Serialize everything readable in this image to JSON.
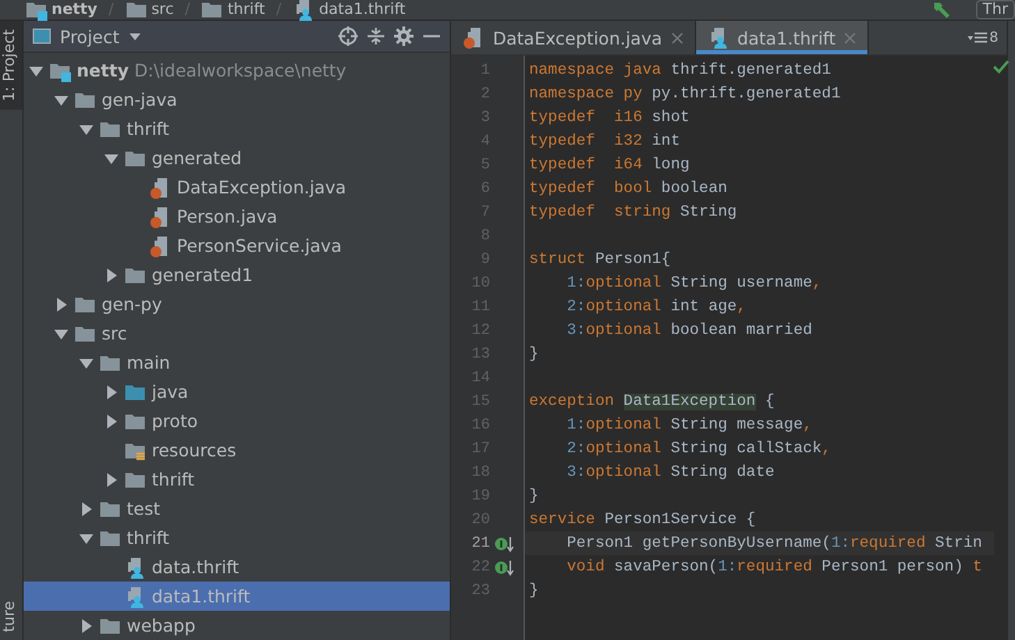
{
  "breadcrumb": [
    {
      "label": "netty",
      "kind": "module"
    },
    {
      "label": "src",
      "kind": "folder"
    },
    {
      "label": "thrift",
      "kind": "folder"
    },
    {
      "label": "data1.thrift",
      "kind": "thrift"
    }
  ],
  "breadcrumb_separator": "/",
  "top_right_label": "Thr",
  "side_tabs": {
    "top": "1: Project",
    "bottom": "ture"
  },
  "project_panel": {
    "title": "Project"
  },
  "tree": [
    {
      "name": "netty",
      "path": "D:\\idealworkspace\\netty",
      "kind": "module",
      "expanded": true,
      "selected": false,
      "children": [
        {
          "name": "gen-java",
          "kind": "folder",
          "expanded": true,
          "selected": false,
          "children": [
            {
              "name": "thrift",
              "kind": "folder",
              "expanded": true,
              "selected": false,
              "children": [
                {
                  "name": "generated",
                  "kind": "folder",
                  "expanded": true,
                  "selected": false,
                  "children": [
                    {
                      "name": "DataException.java",
                      "kind": "java",
                      "selected": false
                    },
                    {
                      "name": "Person.java",
                      "kind": "java",
                      "selected": false
                    },
                    {
                      "name": "PersonService.java",
                      "kind": "java",
                      "selected": false
                    }
                  ]
                },
                {
                  "name": "generated1",
                  "kind": "folder",
                  "expanded": false,
                  "selected": false
                }
              ]
            }
          ]
        },
        {
          "name": "gen-py",
          "kind": "folder",
          "expanded": false,
          "selected": false
        },
        {
          "name": "src",
          "kind": "folder",
          "expanded": true,
          "selected": false,
          "children": [
            {
              "name": "main",
              "kind": "folder",
              "expanded": true,
              "selected": false,
              "children": [
                {
                  "name": "java",
                  "kind": "source",
                  "expanded": false,
                  "selected": false
                },
                {
                  "name": "proto",
                  "kind": "folder",
                  "expanded": false,
                  "selected": false
                },
                {
                  "name": "resources",
                  "kind": "resources",
                  "selected": false
                },
                {
                  "name": "thrift",
                  "kind": "folder",
                  "expanded": false,
                  "selected": false
                }
              ]
            },
            {
              "name": "test",
              "kind": "folder",
              "expanded": false,
              "selected": false
            },
            {
              "name": "thrift",
              "kind": "folder",
              "expanded": true,
              "selected": false,
              "children": [
                {
                  "name": "data.thrift",
                  "kind": "thrift",
                  "selected": false
                },
                {
                  "name": "data1.thrift",
                  "kind": "thrift",
                  "selected": true
                }
              ]
            },
            {
              "name": "webapp",
              "kind": "folder",
              "expanded": false,
              "selected": false
            }
          ]
        }
      ]
    }
  ],
  "editor_tabs": [
    {
      "label": "DataException.java",
      "kind": "java",
      "selected": false
    },
    {
      "label": "data1.thrift",
      "kind": "thrift",
      "selected": true
    }
  ],
  "tab_overflow_count": "8",
  "code": [
    {
      "number": "1",
      "current": false,
      "marker": false,
      "tokens": [
        {
          "kind": "kw",
          "text": "namespace java "
        },
        {
          "kind": "id",
          "text": "thrift.generated1"
        }
      ]
    },
    {
      "number": "2",
      "current": false,
      "marker": false,
      "tokens": [
        {
          "kind": "kw",
          "text": "namespace py "
        },
        {
          "kind": "id",
          "text": "py.thrift.generated1"
        }
      ]
    },
    {
      "number": "3",
      "current": false,
      "marker": false,
      "tokens": [
        {
          "kind": "kw",
          "text": "typedef  i16 "
        },
        {
          "kind": "id",
          "text": "shot"
        }
      ]
    },
    {
      "number": "4",
      "current": false,
      "marker": false,
      "tokens": [
        {
          "kind": "kw",
          "text": "typedef  i32 "
        },
        {
          "kind": "id",
          "text": "int"
        }
      ]
    },
    {
      "number": "5",
      "current": false,
      "marker": false,
      "tokens": [
        {
          "kind": "kw",
          "text": "typedef  i64 "
        },
        {
          "kind": "id",
          "text": "long"
        }
      ]
    },
    {
      "number": "6",
      "current": false,
      "marker": false,
      "tokens": [
        {
          "kind": "kw",
          "text": "typedef  bool "
        },
        {
          "kind": "id",
          "text": "boolean"
        }
      ]
    },
    {
      "number": "7",
      "current": false,
      "marker": false,
      "tokens": [
        {
          "kind": "kw",
          "text": "typedef  string "
        },
        {
          "kind": "id",
          "text": "String"
        }
      ]
    },
    {
      "number": "8",
      "current": false,
      "marker": false
    },
    {
      "number": "9",
      "current": false,
      "marker": false,
      "tokens": [
        {
          "kind": "kw",
          "text": "struct "
        },
        {
          "kind": "id",
          "text": "Person1{"
        }
      ]
    },
    {
      "number": "10",
      "current": false,
      "marker": false,
      "tokens": [
        {
          "kind": "num",
          "text": "    1:"
        },
        {
          "kind": "kw",
          "text": "optional "
        },
        {
          "kind": "id",
          "text": "String username"
        },
        {
          "kind": "kw",
          "text": ","
        }
      ]
    },
    {
      "number": "11",
      "current": false,
      "marker": false,
      "tokens": [
        {
          "kind": "num",
          "text": "    2:"
        },
        {
          "kind": "kw",
          "text": "optional "
        },
        {
          "kind": "id",
          "text": "int age"
        },
        {
          "kind": "kw",
          "text": ","
        }
      ]
    },
    {
      "number": "12",
      "current": false,
      "marker": false,
      "tokens": [
        {
          "kind": "num",
          "text": "    3:"
        },
        {
          "kind": "kw",
          "text": "optional "
        },
        {
          "kind": "id",
          "text": "boolean married"
        }
      ]
    },
    {
      "number": "13",
      "current": false,
      "marker": false,
      "tokens": [
        {
          "kind": "id",
          "text": "}"
        }
      ]
    },
    {
      "number": "14",
      "current": false,
      "marker": false
    },
    {
      "number": "15",
      "current": false,
      "marker": false,
      "tokens": [
        {
          "kind": "kw",
          "text": "exception "
        },
        {
          "kind": "hl",
          "text": "Data1Exception"
        },
        {
          "kind": "id",
          "text": " {"
        }
      ]
    },
    {
      "number": "16",
      "current": false,
      "marker": false,
      "tokens": [
        {
          "kind": "num",
          "text": "    1:"
        },
        {
          "kind": "kw",
          "text": "optional "
        },
        {
          "kind": "id",
          "text": "String message"
        },
        {
          "kind": "kw",
          "text": ","
        }
      ]
    },
    {
      "number": "17",
      "current": false,
      "marker": false,
      "tokens": [
        {
          "kind": "num",
          "text": "    2:"
        },
        {
          "kind": "kw",
          "text": "optional "
        },
        {
          "kind": "id",
          "text": "String callStack"
        },
        {
          "kind": "kw",
          "text": ","
        }
      ]
    },
    {
      "number": "18",
      "current": false,
      "marker": false,
      "tokens": [
        {
          "kind": "num",
          "text": "    3:"
        },
        {
          "kind": "kw",
          "text": "optional "
        },
        {
          "kind": "id",
          "text": "String date"
        }
      ]
    },
    {
      "number": "19",
      "current": false,
      "marker": false,
      "tokens": [
        {
          "kind": "id",
          "text": "}"
        }
      ]
    },
    {
      "number": "20",
      "current": false,
      "marker": false,
      "tokens": [
        {
          "kind": "kw",
          "text": "service "
        },
        {
          "kind": "id",
          "text": "Person1Service {"
        }
      ]
    },
    {
      "number": "21",
      "current": true,
      "marker": true,
      "tokens": [
        {
          "kind": "id",
          "text": "    Person1 getPersonByUsername("
        },
        {
          "kind": "num",
          "text": "1:"
        },
        {
          "kind": "kw",
          "text": "required "
        },
        {
          "kind": "id",
          "text": "Strin"
        }
      ]
    },
    {
      "number": "22",
      "current": false,
      "marker": true,
      "tokens": [
        {
          "kind": "kw",
          "text": "    void "
        },
        {
          "kind": "id",
          "text": "savaPerson("
        },
        {
          "kind": "num",
          "text": "1:"
        },
        {
          "kind": "kw",
          "text": "required "
        },
        {
          "kind": "id",
          "text": "Person1 person) "
        },
        {
          "kind": "kw",
          "text": "t"
        }
      ]
    },
    {
      "number": "23",
      "current": false,
      "marker": false,
      "tokens": [
        {
          "kind": "id",
          "text": "}"
        }
      ]
    }
  ]
}
